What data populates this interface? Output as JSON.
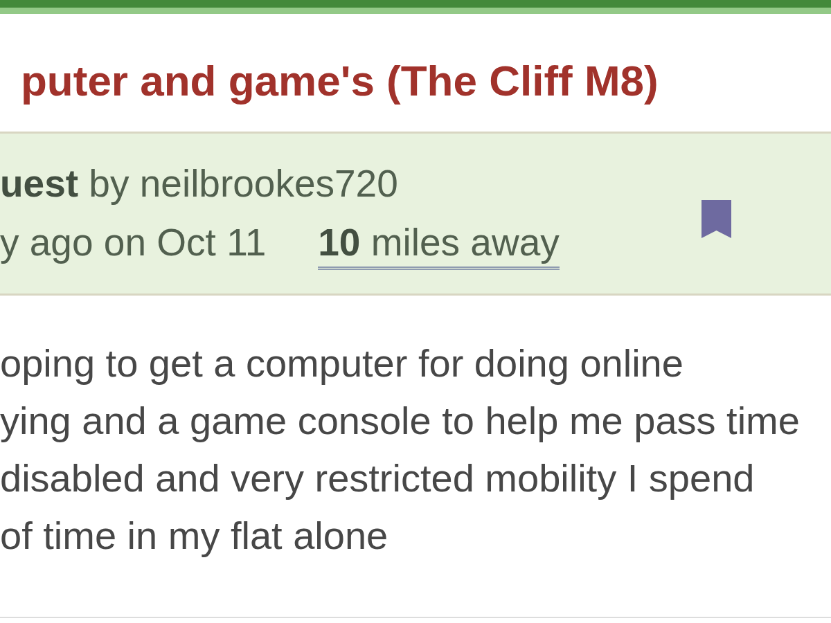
{
  "post": {
    "title": "puter and game's (The Cliff M8)",
    "byline": "**uest** by neilbrookes720",
    "posted": "y ago on Oct 11",
    "distance": "**10** miles away",
    "description_lines": [
      "oping to get a computer for doing online",
      "ying and a game console to help me pass time",
      "disabled and very restricted mobility I spend",
      "of time in my flat alone"
    ]
  }
}
